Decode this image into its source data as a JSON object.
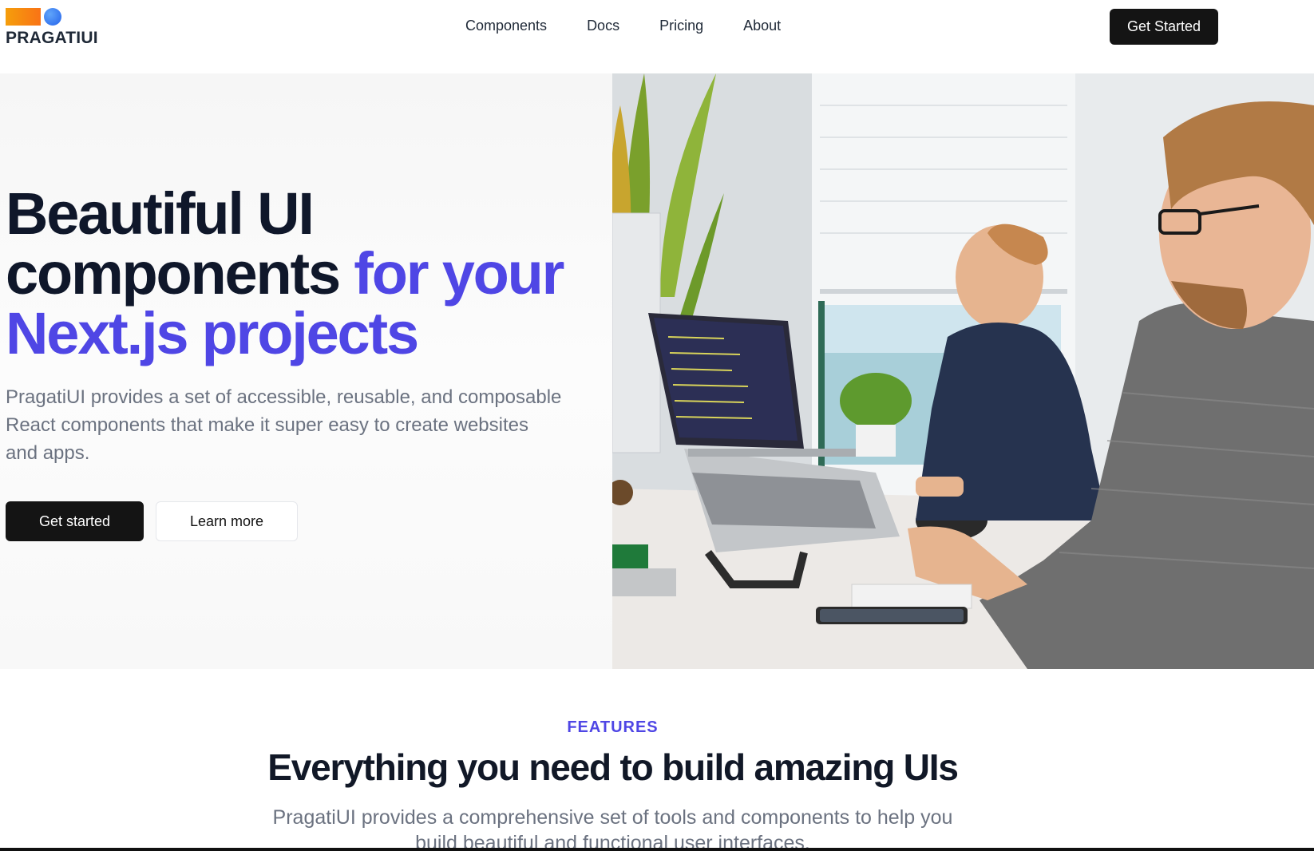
{
  "header": {
    "logo_text": "PRAGATIUI",
    "nav": [
      "Components",
      "Docs",
      "Pricing",
      "About"
    ],
    "cta_label": "Get Started"
  },
  "hero": {
    "title_line1": "Beautiful UI",
    "title_line2": "components",
    "title_accent_1": "for your",
    "title_accent_2": "Next.js projects",
    "subtitle": "PragatiUI provides a set of accessible, reusable, and composable React components that make it super easy to create websites and apps.",
    "primary_label": "Get started",
    "secondary_label": "Learn more"
  },
  "features": {
    "eyebrow": "FEATURES",
    "title": "Everything you need to build amazing UIs",
    "subtitle": "PragatiUI provides a comprehensive set of tools and components to help you build beautiful and functional user interfaces."
  },
  "colors": {
    "accent": "#4f46e5",
    "button_dark": "#141414",
    "muted_text": "#6b7280"
  }
}
